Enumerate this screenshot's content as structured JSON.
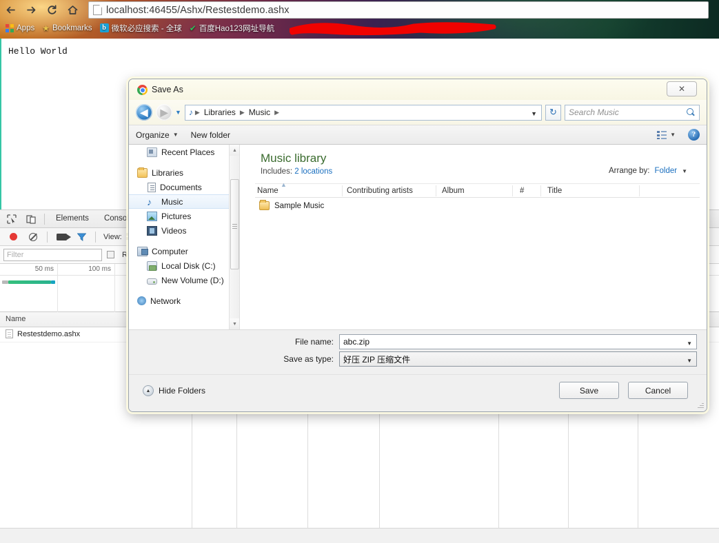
{
  "browser": {
    "nav": {
      "back_label": "Back",
      "forward_label": "Forward",
      "reload_label": "Reload",
      "home_label": "Home"
    },
    "omnibox": {
      "host": "localhost:46455",
      "path": "/Ashx/Restestdemo.ashx",
      "full_url": "localhost:46455/Ashx/Restestdemo.ashx"
    },
    "bookmarks": [
      {
        "label": "Apps",
        "icon": "apps-grid-icon"
      },
      {
        "label": "Bookmarks",
        "icon": "star-icon"
      },
      {
        "label": "微软必应搜索 - 全球",
        "icon": "bing-icon"
      },
      {
        "label": "百度Hao123网址导航",
        "icon": "baidu-check-icon"
      }
    ]
  },
  "page": {
    "content": "Hello World"
  },
  "devtools": {
    "tabs": [
      "Elements",
      "Console"
    ],
    "toolbar": {
      "record_label": "Record",
      "clear_label": "Clear",
      "camera_label": "Capture screenshots",
      "filter_label": "Filter",
      "view_label": "View:"
    },
    "filter": {
      "placeholder": "Filter",
      "regex_label": "Re"
    },
    "timeline": {
      "ticks": [
        "50 ms",
        "100 ms"
      ],
      "bar_color_wait": "#a8a8a8",
      "bar_color_download": "#2fbf7a",
      "bar_color_end": "#17a4c2"
    },
    "table": {
      "columns": [
        "Name"
      ],
      "rows": [
        {
          "name": "Restestdemo.ashx"
        }
      ]
    }
  },
  "dialog": {
    "title": "Save As",
    "close_label": "✕",
    "nav": {
      "back": "◀",
      "forward": "▶",
      "history_caret": "▼",
      "refresh_label": "Refresh",
      "breadcrumbs": [
        "Libraries",
        "Music"
      ],
      "breadcrumb_caret": "▼"
    },
    "search": {
      "placeholder": "Search Music"
    },
    "toolbar": {
      "organize_label": "Organize",
      "new_folder_label": "New folder",
      "view_label": "Change your view",
      "help_label": "?"
    },
    "sidebar": [
      {
        "label": "Recent Places",
        "icon": "recent-places-icon",
        "level": "child",
        "selected": false
      },
      {
        "gap": true
      },
      {
        "label": "Libraries",
        "icon": "libraries-icon",
        "level": "root",
        "selected": false
      },
      {
        "label": "Documents",
        "icon": "documents-icon",
        "level": "child",
        "selected": false
      },
      {
        "label": "Music",
        "icon": "music-note-icon",
        "level": "child",
        "selected": true
      },
      {
        "label": "Pictures",
        "icon": "pictures-icon",
        "level": "child",
        "selected": false
      },
      {
        "label": "Videos",
        "icon": "videos-icon",
        "level": "child",
        "selected": false
      },
      {
        "gap": true
      },
      {
        "label": "Computer",
        "icon": "computer-icon",
        "level": "root",
        "selected": false
      },
      {
        "label": "Local Disk (C:)",
        "icon": "local-disk-icon",
        "level": "child",
        "selected": false
      },
      {
        "label": "New Volume (D:)",
        "icon": "drive-icon",
        "level": "child",
        "selected": false
      },
      {
        "gap": true
      },
      {
        "label": "Network",
        "icon": "network-icon",
        "level": "root",
        "selected": false
      }
    ],
    "content": {
      "library_title": "Music library",
      "includes_label": "Includes:",
      "includes_value": "2 locations",
      "arrange_by_label": "Arrange by:",
      "arrange_by_value": "Folder",
      "arrange_caret": "▼",
      "columns": [
        "Name",
        "Contributing artists",
        "Album",
        "#",
        "Title"
      ],
      "rows": [
        {
          "name": "Sample Music",
          "artists": "",
          "album": "",
          "number": "",
          "title": ""
        }
      ]
    },
    "form": {
      "file_name_label": "File name:",
      "file_name_value": "abc.zip",
      "save_as_type_label": "Save as type:",
      "save_as_type_value": "好压 ZIP 压缩文件",
      "caret": "▼"
    },
    "footer": {
      "hide_folders_label": "Hide Folders",
      "hide_folders_caret": "▲",
      "save_label": "Save",
      "cancel_label": "Cancel"
    }
  }
}
